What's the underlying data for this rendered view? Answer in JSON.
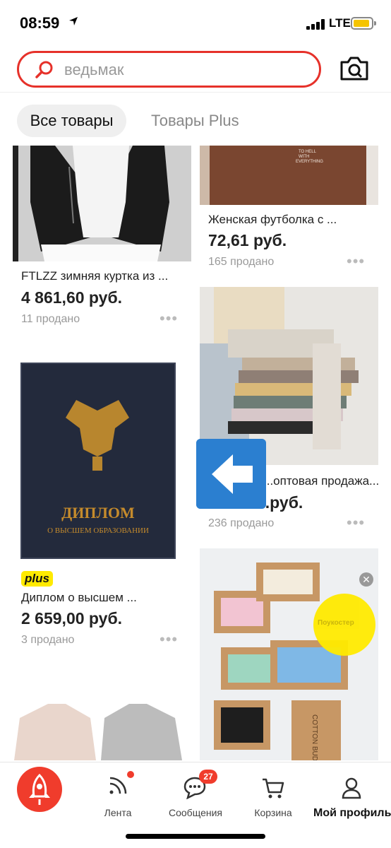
{
  "status": {
    "time": "08:59",
    "network": "LTE",
    "colors": {
      "battery": "#f5c400"
    }
  },
  "search": {
    "query": "ведьмак",
    "accent": "#e6312a"
  },
  "tabs": {
    "all": "Все товары",
    "plus": "Товары Plus"
  },
  "products": [
    {
      "title": "FTLZZ зимняя куртка из ...",
      "price": "4 861,60 руб.",
      "sold": "11 продано"
    },
    {
      "title": "Женская футболка с ...",
      "price": "72,61 руб.",
      "sold": "165 продано",
      "print_text": "TO HELL WITH EVERYTHING"
    },
    {
      "title": "Диплом о высшем ...",
      "price": "2 659,00 руб.",
      "sold": "3 продано",
      "badge": "plus",
      "image_text": {
        "line1": "ДИПЛОМ",
        "line2": "О ВЫСШЕМ ОБРАЗОВАНИИ"
      }
    },
    {
      "title": "...оптовая продажа...",
      "price": "...руб.",
      "sold": "236 продано"
    },
    {
      "image_text": {
        "box": "COTTON BUDS",
        "bubble": "Поукостер"
      }
    }
  ],
  "more_icon": "•••",
  "nav": {
    "feed": "Лента",
    "messages": "Сообщения",
    "messages_count": "27",
    "cart": "Корзина",
    "profile": "Мой профиль"
  },
  "icons": [
    "location-arrow-icon",
    "search-icon",
    "camera-icon",
    "back-arrow-icon",
    "close-icon",
    "rocket-icon",
    "feed-icon",
    "chat-icon",
    "cart-icon",
    "profile-icon"
  ]
}
